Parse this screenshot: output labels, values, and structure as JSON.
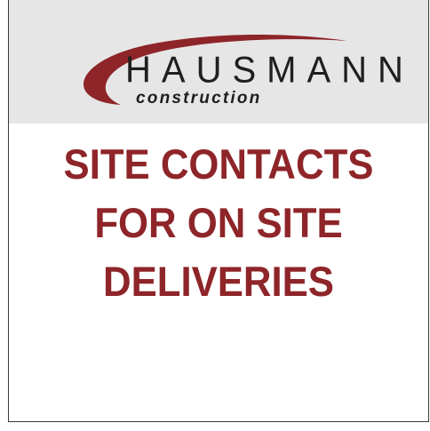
{
  "sign": {
    "brand": {
      "name": "HAUSMANN",
      "tagline": "construction"
    },
    "headline": [
      "SITE CONTACTS",
      "FOR ON SITE",
      "DELIVERIES"
    ]
  },
  "colors": {
    "header_background": "#e6e6e6",
    "brand_red": "#8e2529",
    "brand_text": "#1f1f1f"
  }
}
